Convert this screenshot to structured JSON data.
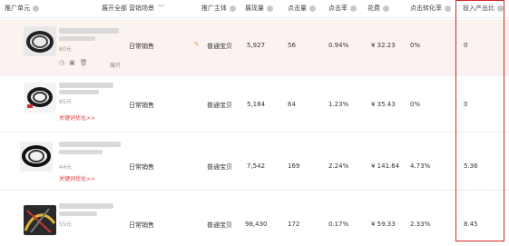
{
  "header": {
    "unit": "推广单元",
    "expand_all": "展开全部",
    "scene": "营销场景",
    "subject": "推广主体",
    "impressions": "展现量",
    "clicks": "点击量",
    "ctr": "点击率",
    "cost": "花费",
    "cvr": "点击转化率",
    "roi": "投入产出比"
  },
  "rows": [
    {
      "price": "60元",
      "keyword_link": "",
      "expand": "展开",
      "scene": "日常销售",
      "subject": "普通宝贝",
      "impressions": "5,927",
      "clicks": "56",
      "ctr": "0.94%",
      "cost": "¥ 32.23",
      "cvr": "0%",
      "roi": "0"
    },
    {
      "price": "65元",
      "keyword_link": "关键词优化>>",
      "expand": "",
      "scene": "日常销售",
      "subject": "普通宝贝",
      "impressions": "5,184",
      "clicks": "64",
      "ctr": "1.23%",
      "cost": "¥ 35.43",
      "cvr": "0%",
      "roi": "0"
    },
    {
      "price": "44元",
      "keyword_link": "关键词优化>>",
      "expand": "",
      "scene": "日常销售",
      "subject": "普通宝贝",
      "impressions": "7,542",
      "clicks": "169",
      "ctr": "2.24%",
      "cost": "¥ 141.64",
      "cvr": "4.73%",
      "roi": "5.36"
    },
    {
      "price": "55元",
      "keyword_link": "",
      "expand": "",
      "scene": "日常销售",
      "subject": "普通宝贝",
      "impressions": "98,430",
      "clicks": "172",
      "ctr": "0.17%",
      "cost": "¥ 59.33",
      "cvr": "2.33%",
      "roi": "8.45"
    }
  ],
  "colors": {
    "highlight_row": "#fbf3ef",
    "red_box": "#d9262b",
    "keyword_link": "#e4393c"
  }
}
